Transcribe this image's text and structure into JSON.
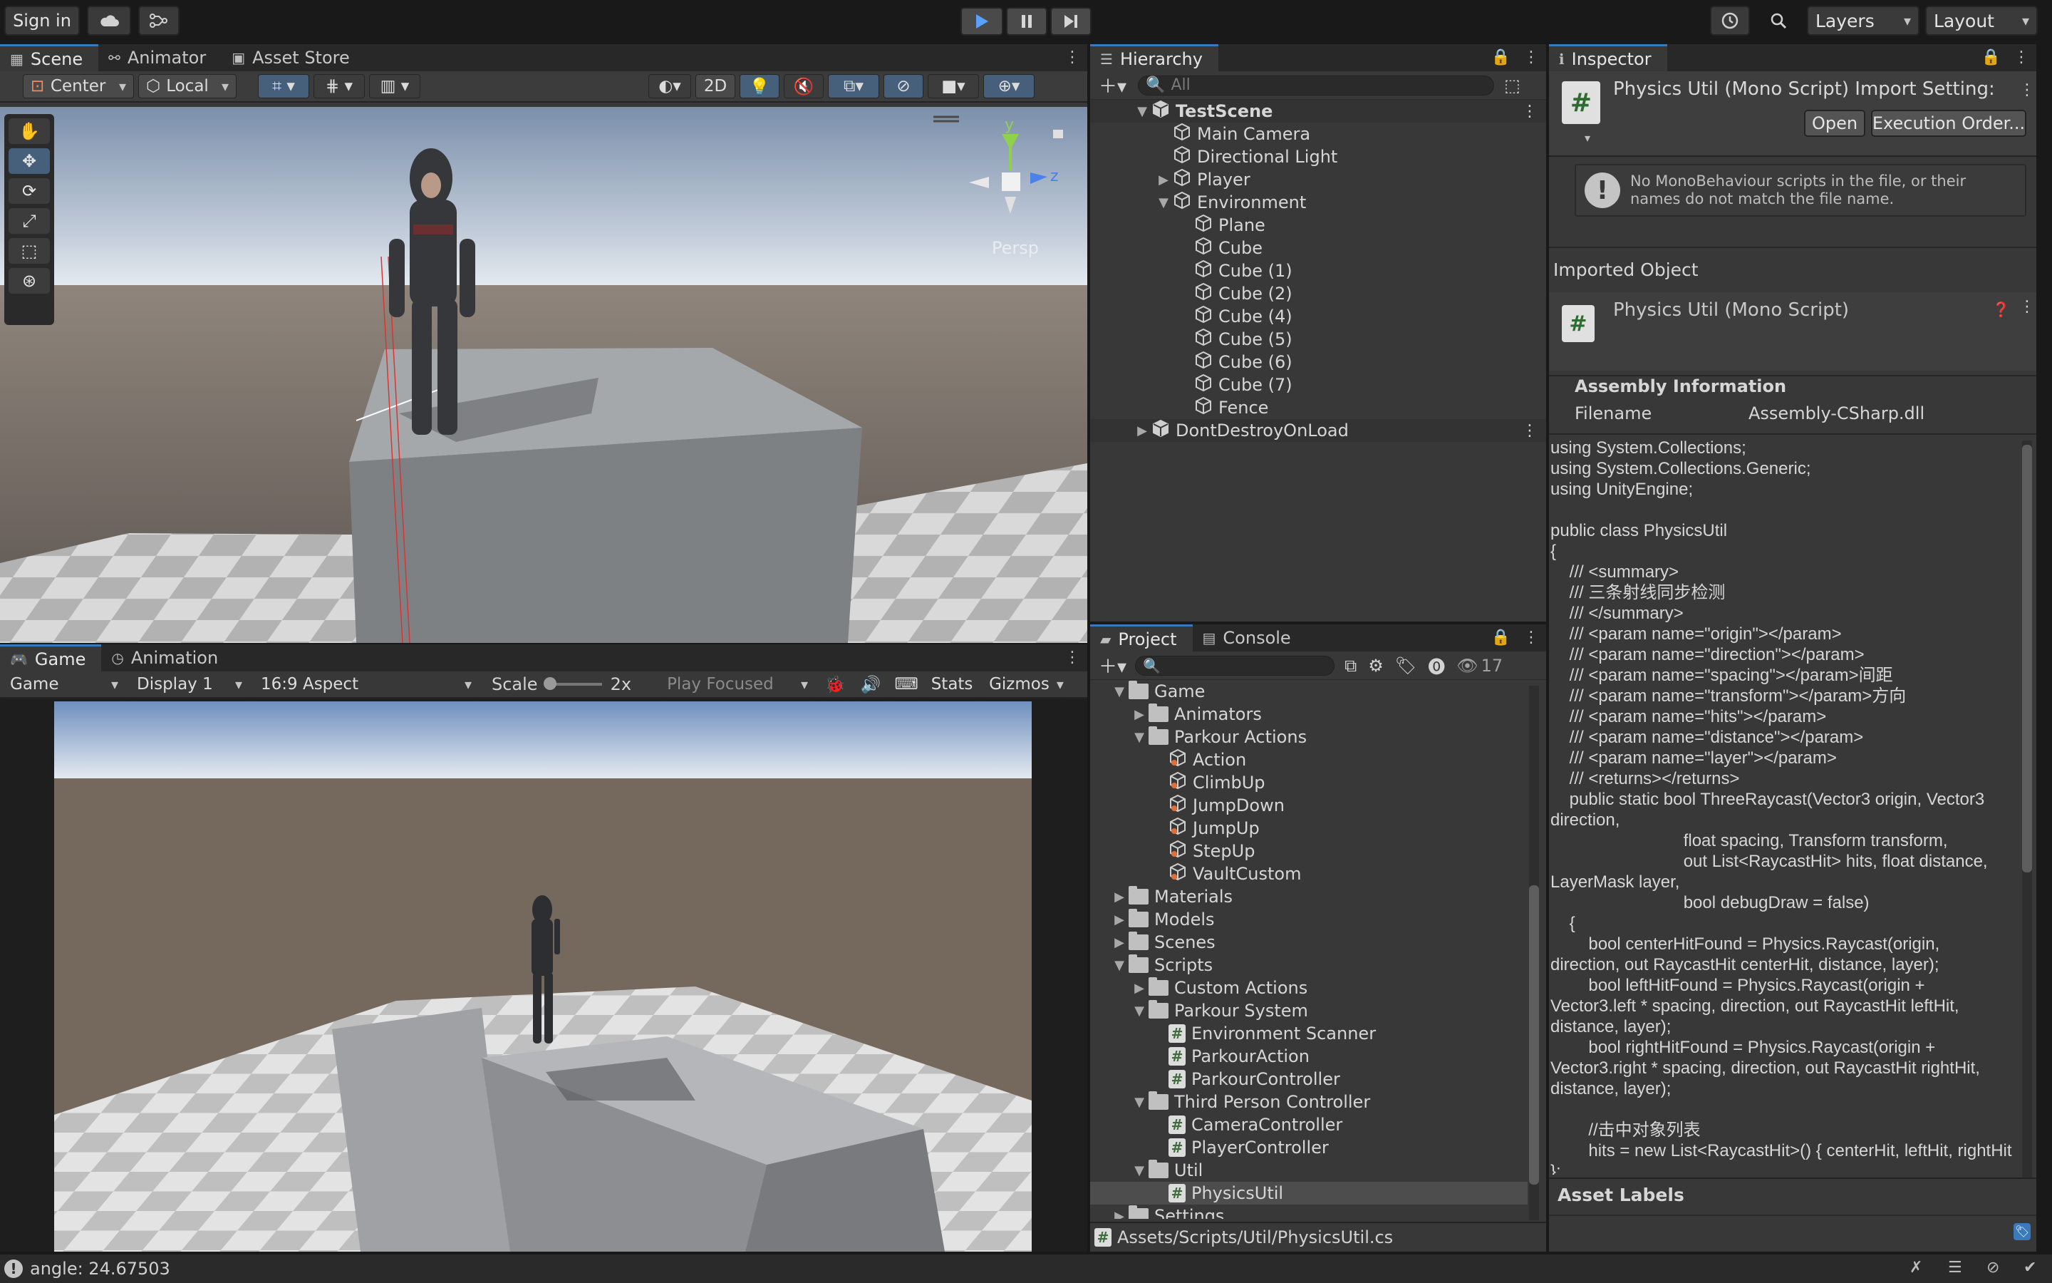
{
  "toolbar": {
    "sign_in": "Sign in",
    "layers": "Layers",
    "layout": "Layout"
  },
  "scene": {
    "tabs": [
      "Scene",
      "Animator",
      "Asset Store"
    ],
    "pivot": "Center",
    "space": "Local",
    "mode_2d": "2D",
    "persp_label": "Persp",
    "gizmo_y": "y",
    "gizmo_z": "z"
  },
  "game": {
    "tabs": [
      "Game",
      "Animation"
    ],
    "display_mode": "Game",
    "display": "Display 1",
    "aspect": "16:9 Aspect",
    "scale_label": "Scale",
    "scale_value": "2x",
    "play_focused": "Play Focused",
    "stats": "Stats",
    "gizmos": "Gizmos"
  },
  "hierarchy": {
    "tab": "Hierarchy",
    "search_placeholder": "All",
    "rows": [
      {
        "label": "TestScene",
        "indent": 0,
        "kind": "scene",
        "arrow": "down",
        "bold": true
      },
      {
        "label": "Main Camera",
        "indent": 1,
        "kind": "cube",
        "arrow": ""
      },
      {
        "label": "Directional Light",
        "indent": 1,
        "kind": "cube",
        "arrow": ""
      },
      {
        "label": "Player",
        "indent": 1,
        "kind": "cube",
        "arrow": "right"
      },
      {
        "label": "Environment",
        "indent": 1,
        "kind": "cube",
        "arrow": "down"
      },
      {
        "label": "Plane",
        "indent": 2,
        "kind": "cube",
        "arrow": ""
      },
      {
        "label": "Cube",
        "indent": 2,
        "kind": "cube",
        "arrow": ""
      },
      {
        "label": "Cube (1)",
        "indent": 2,
        "kind": "cube",
        "arrow": ""
      },
      {
        "label": "Cube (2)",
        "indent": 2,
        "kind": "cube",
        "arrow": ""
      },
      {
        "label": "Cube (4)",
        "indent": 2,
        "kind": "cube",
        "arrow": ""
      },
      {
        "label": "Cube (5)",
        "indent": 2,
        "kind": "cube",
        "arrow": ""
      },
      {
        "label": "Cube (6)",
        "indent": 2,
        "kind": "cube",
        "arrow": ""
      },
      {
        "label": "Cube (7)",
        "indent": 2,
        "kind": "cube",
        "arrow": ""
      },
      {
        "label": "Fence",
        "indent": 2,
        "kind": "cube",
        "arrow": ""
      },
      {
        "label": "DontDestroyOnLoad",
        "indent": 0,
        "kind": "scene",
        "arrow": "right"
      }
    ]
  },
  "project": {
    "tabs": [
      "Project",
      "Console"
    ],
    "hidden_count": "17",
    "path": "Assets/Scripts/Util/PhysicsUtil.cs",
    "rows": [
      {
        "label": "Game",
        "indent": 1,
        "kind": "folder",
        "arrow": "down"
      },
      {
        "label": "Animators",
        "indent": 2,
        "kind": "folder",
        "arrow": "right"
      },
      {
        "label": "Parkour Actions",
        "indent": 2,
        "kind": "folder",
        "arrow": "down"
      },
      {
        "label": "Action",
        "indent": 3,
        "kind": "asset",
        "arrow": ""
      },
      {
        "label": "ClimbUp",
        "indent": 3,
        "kind": "asset",
        "arrow": ""
      },
      {
        "label": "JumpDown",
        "indent": 3,
        "kind": "asset",
        "arrow": ""
      },
      {
        "label": "JumpUp",
        "indent": 3,
        "kind": "asset",
        "arrow": ""
      },
      {
        "label": "StepUp",
        "indent": 3,
        "kind": "asset",
        "arrow": ""
      },
      {
        "label": "VaultCustom",
        "indent": 3,
        "kind": "asset",
        "arrow": ""
      },
      {
        "label": "Materials",
        "indent": 1,
        "kind": "folder",
        "arrow": "right"
      },
      {
        "label": "Models",
        "indent": 1,
        "kind": "folder",
        "arrow": "right"
      },
      {
        "label": "Scenes",
        "indent": 1,
        "kind": "folder",
        "arrow": "right"
      },
      {
        "label": "Scripts",
        "indent": 1,
        "kind": "folder",
        "arrow": "down"
      },
      {
        "label": "Custom Actions",
        "indent": 2,
        "kind": "folder",
        "arrow": "right"
      },
      {
        "label": "Parkour System",
        "indent": 2,
        "kind": "folder",
        "arrow": "down"
      },
      {
        "label": "Environment Scanner",
        "indent": 3,
        "kind": "script",
        "arrow": ""
      },
      {
        "label": "ParkourAction",
        "indent": 3,
        "kind": "script",
        "arrow": ""
      },
      {
        "label": "ParkourController",
        "indent": 3,
        "kind": "script",
        "arrow": ""
      },
      {
        "label": "Third Person Controller",
        "indent": 2,
        "kind": "folder",
        "arrow": "down"
      },
      {
        "label": "CameraController",
        "indent": 3,
        "kind": "script",
        "arrow": ""
      },
      {
        "label": "PlayerController",
        "indent": 3,
        "kind": "script",
        "arrow": ""
      },
      {
        "label": "Util",
        "indent": 2,
        "kind": "folder",
        "arrow": "down"
      },
      {
        "label": "PhysicsUtil",
        "indent": 3,
        "kind": "script",
        "arrow": "",
        "selected": true
      },
      {
        "label": "Settings",
        "indent": 1,
        "kind": "folder",
        "arrow": "right"
      }
    ]
  },
  "inspector": {
    "tab": "Inspector",
    "title": "Physics Util (Mono Script) Import Setting:",
    "open": "Open",
    "execution_order": "Execution Order...",
    "warning": "No MonoBehaviour scripts in the file, or their names do not match the file name.",
    "imported_object": "Imported Object",
    "object_name": "Physics Util (Mono Script)",
    "assembly_info": "Assembly Information",
    "filename_label": "Filename",
    "filename_value": "Assembly-CSharp.dll",
    "asset_labels": "Asset Labels",
    "code_lines": [
      "using System.Collections;",
      "using System.Collections.Generic;",
      "using UnityEngine;",
      "",
      "public class PhysicsUtil",
      "{",
      "    /// <summary>",
      "    /// 三条射线同步检测",
      "    /// </summary>",
      "    /// <param name=\"origin\"></param>",
      "    /// <param name=\"direction\"></param>",
      "    /// <param name=\"spacing\"></param>间距",
      "    /// <param name=\"transform\"></param>方向",
      "    /// <param name=\"hits\"></param>",
      "    /// <param name=\"distance\"></param>",
      "    /// <param name=\"layer\"></param>",
      "    /// <returns></returns>",
      "    public static bool ThreeRaycast(Vector3 origin, Vector3 direction,",
      "                            float spacing, Transform transform,",
      "                            out List<RaycastHit> hits, float distance, LayerMask layer,",
      "                            bool debugDraw = false)",
      "    {",
      "        bool centerHitFound = Physics.Raycast(origin, direction, out RaycastHit centerHit, distance, layer);",
      "        bool leftHitFound = Physics.Raycast(origin + Vector3.left * spacing, direction, out RaycastHit leftHit, distance, layer);",
      "        bool rightHitFound = Physics.Raycast(origin + Vector3.right * spacing, direction, out RaycastHit rightHit, distance, layer);",
      "",
      "        //击中对象列表",
      "        hits = new List<RaycastHit>() { centerHit, leftHit, rightHit };"
    ]
  },
  "status": {
    "text": "angle: 24.67503"
  },
  "colors": {
    "accent": "#3a79bb",
    "panel": "#383838",
    "background": "#191919"
  }
}
